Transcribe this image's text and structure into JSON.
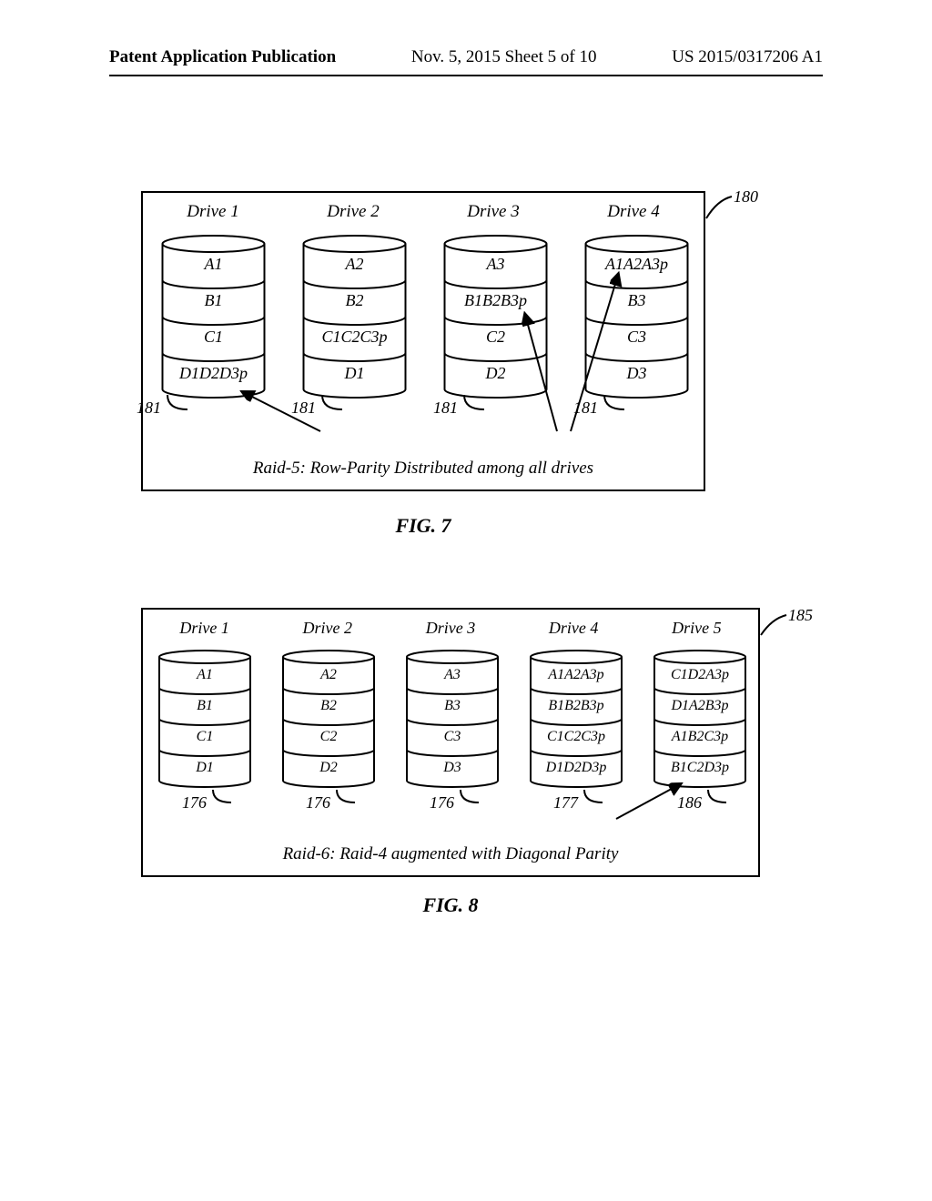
{
  "header": {
    "left": "Patent Application Publication",
    "center": "Nov. 5, 2015  Sheet 5 of 10",
    "right": "US 2015/0317206 A1"
  },
  "fig7": {
    "drive_headers": [
      "Drive 1",
      "Drive 2",
      "Drive 3",
      "Drive 4"
    ],
    "caption": "Raid-5: Row-Parity Distributed among all drives",
    "label": "FIG. 7",
    "ref_box": "180",
    "ref_cyls": [
      "181",
      "181",
      "181",
      "181"
    ]
  },
  "fig8": {
    "drive_headers": [
      "Drive 1",
      "Drive 2",
      "Drive 3",
      "Drive 4",
      "Drive 5"
    ],
    "caption": "Raid-6: Raid-4 augmented with Diagonal Parity",
    "label": "FIG. 8",
    "ref_box": "185",
    "ref_cyls": [
      "176",
      "176",
      "176",
      "177",
      "186"
    ]
  },
  "chart_data": [
    {
      "type": "table",
      "title": "RAID-5 drive layout",
      "columns": [
        "Drive 1",
        "Drive 2",
        "Drive 3",
        "Drive 4"
      ],
      "rows": [
        [
          "A1",
          "A2",
          "A3",
          "A1A2A3p"
        ],
        [
          "B1",
          "B2",
          "B1B2B3p",
          "B3"
        ],
        [
          "C1",
          "C1C2C3p",
          "C2",
          "C3"
        ],
        [
          "D1D2D3p",
          "D1",
          "D2",
          "D3"
        ]
      ],
      "caption": "Raid-5: Row-Parity Distributed among all drives"
    },
    {
      "type": "table",
      "title": "RAID-6 drive layout",
      "columns": [
        "Drive 1",
        "Drive 2",
        "Drive 3",
        "Drive 4",
        "Drive 5"
      ],
      "rows": [
        [
          "A1",
          "A2",
          "A3",
          "A1A2A3p",
          "C1D2A3p"
        ],
        [
          "B1",
          "B2",
          "B3",
          "B1B2B3p",
          "D1A2B3p"
        ],
        [
          "C1",
          "C2",
          "C3",
          "C1C2C3p",
          "A1B2C3p"
        ],
        [
          "D1",
          "D2",
          "D3",
          "D1D2D3p",
          "B1C2D3p"
        ]
      ],
      "caption": "Raid-6: Raid-4 augmented with Diagonal Parity"
    }
  ]
}
